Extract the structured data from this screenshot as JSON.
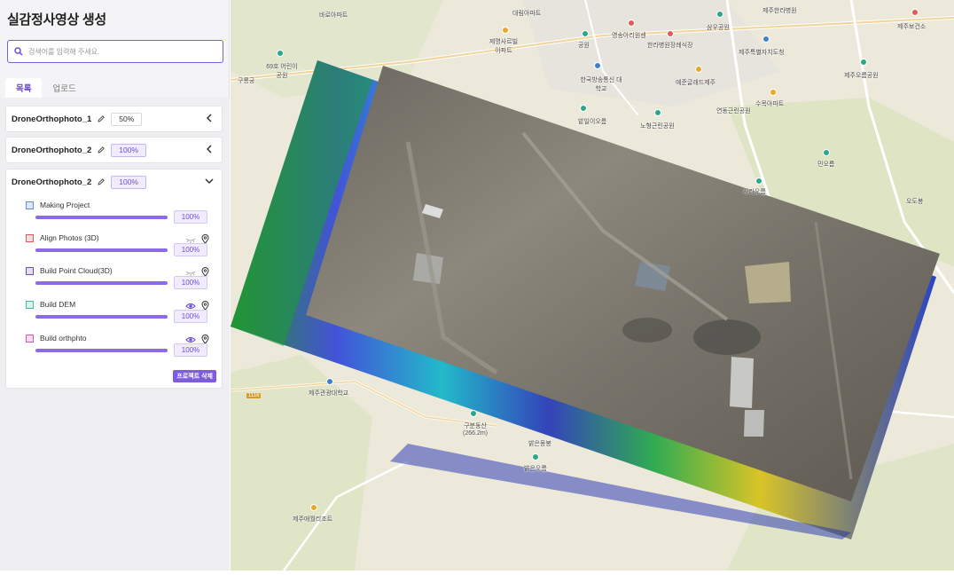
{
  "sidebar": {
    "title": "실감정사영상 생성",
    "search_placeholder": "검색어를 입력해 주세요.",
    "tabs": [
      {
        "label": "목록",
        "active": true
      },
      {
        "label": "업로드",
        "active": false
      }
    ],
    "projects": [
      {
        "name": "DroneOrthophoto_1",
        "progress": "50%",
        "expanded": false
      },
      {
        "name": "DroneOrthophoto_2",
        "progress": "100%",
        "expanded": false
      },
      {
        "name": "DroneOrthophoto_2",
        "progress": "100%",
        "expanded": true,
        "tasks": [
          {
            "label": "Making Project",
            "progress": "100%",
            "color": "#5b8def",
            "icons": []
          },
          {
            "label": "Align Photos (3D)",
            "progress": "100%",
            "color": "#e05a5a",
            "icons": [
              "eye-closed-icon",
              "location-pin-icon"
            ]
          },
          {
            "label": "Build Point Cloud(3D)",
            "progress": "100%",
            "color": "#6f4bd8",
            "icons": [
              "eye-closed-icon",
              "location-pin-icon"
            ]
          },
          {
            "label": "Build DEM",
            "progress": "100%",
            "color": "#3cbf9c",
            "icons": [
              "eye-icon",
              "location-pin-icon"
            ]
          },
          {
            "label": "Build orthphto",
            "progress": "100%",
            "color": "#e054b0",
            "icons": [
              "eye-icon",
              "location-pin-icon"
            ]
          }
        ],
        "delete_label": "프로젝트 삭제"
      }
    ]
  },
  "map": {
    "labels": [
      "바로아파트",
      "대림아파트",
      "제주한라병원",
      "제주보건소",
      "삼우공원",
      "제주특별자치도청",
      "제명사르빌 아파트",
      "공원",
      "영송아리원센",
      "한라병원장례식장",
      "69호 어린이공원",
      "구룡궁",
      "한국방송통신 대학교",
      "예준글래드제주",
      "수목아파트",
      "제주오름공원",
      "연동근린공원",
      "밭일이오름",
      "노형근린공원",
      "민오름",
      "오도봉",
      "사라오름",
      "제주관광대학교",
      "구분동산 (266.2m)",
      "밝은몽봉",
      "밝은오름",
      "제주애월리조트",
      "1116"
    ]
  },
  "colors": {
    "accent": "#6f4bd8",
    "bar": "#8b6be6",
    "map_base": "#ebe7d8",
    "forest": "#dfe5c4"
  }
}
